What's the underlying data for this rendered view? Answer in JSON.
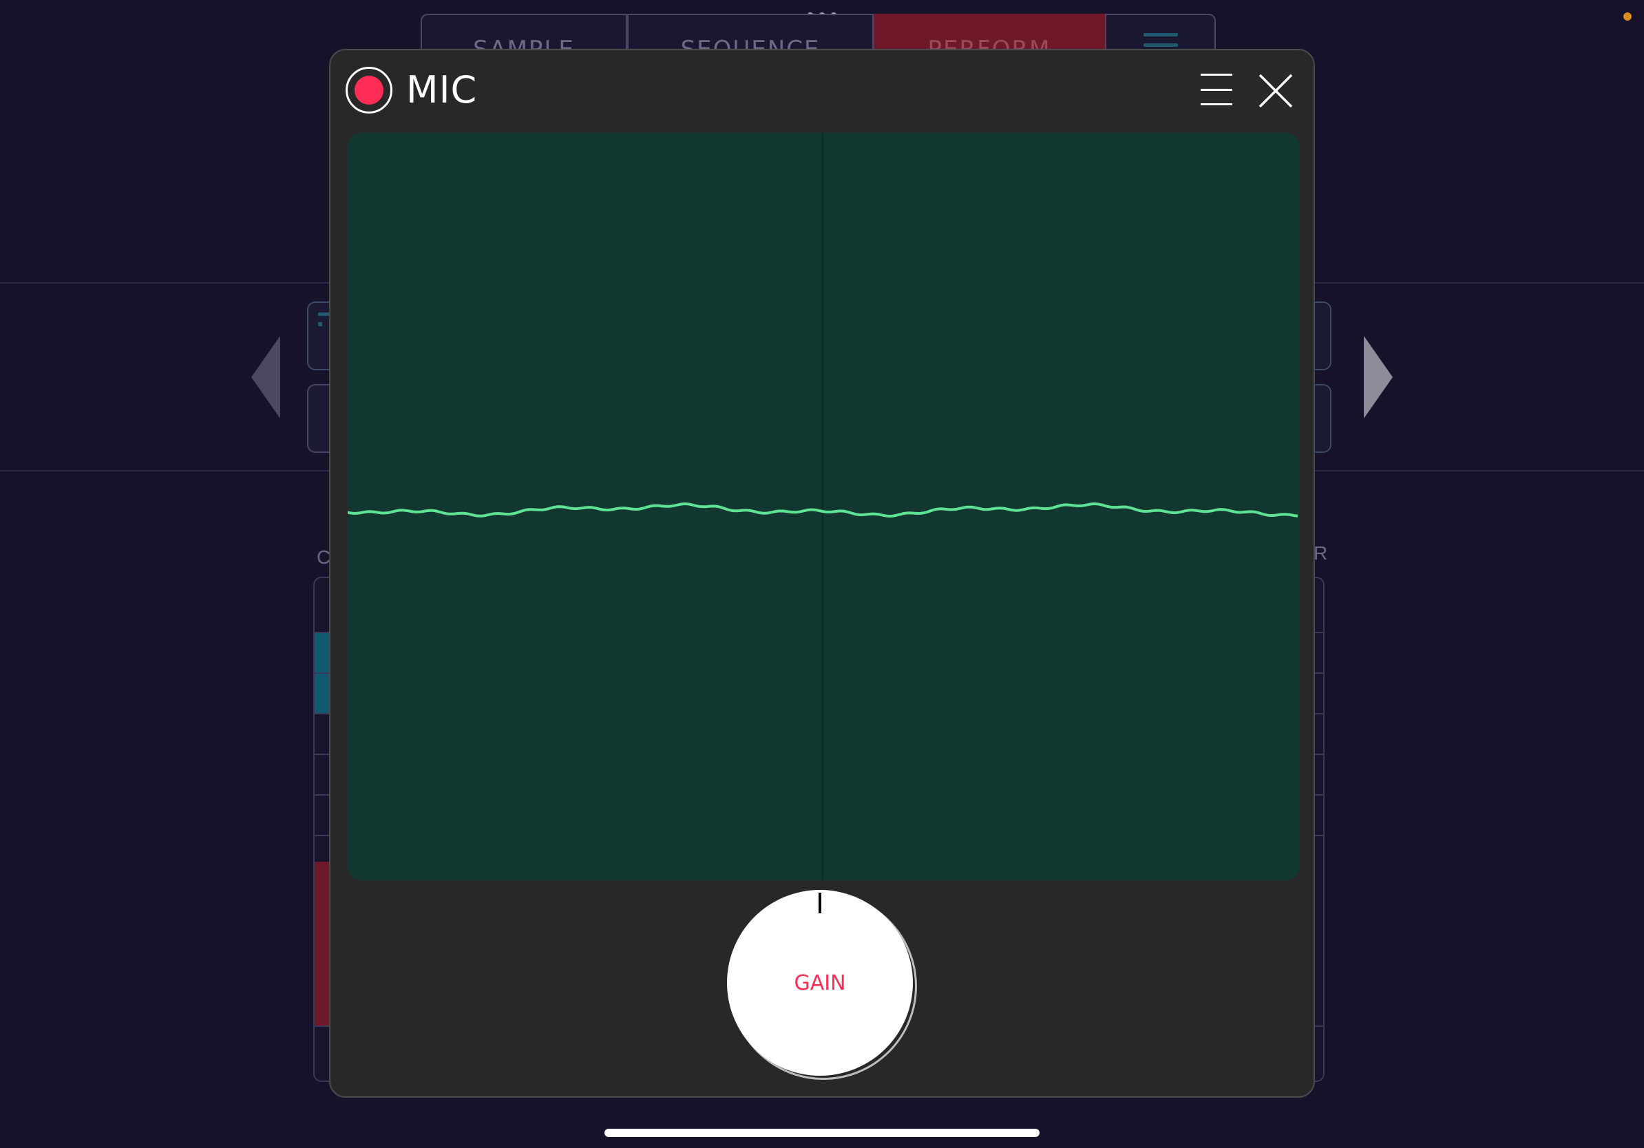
{
  "colors": {
    "background": "#15122a",
    "dialog": "#282828",
    "scope": "#113730",
    "waveform": "#5ee394",
    "record": "#ff2d55",
    "status_dot": "#d98a1d"
  },
  "top_tabs": [
    {
      "label": "SAMPLE"
    },
    {
      "label": "SEQUENCE"
    },
    {
      "label": "PERFORM"
    }
  ],
  "side_labels": {
    "left": "C",
    "right": "R"
  },
  "dialog": {
    "title": "MIC",
    "icons": {
      "record": "record-icon",
      "menu": "hamburger-icon",
      "close": "close-icon"
    }
  },
  "gain_knob": {
    "label": "GAIN",
    "value": 0
  }
}
